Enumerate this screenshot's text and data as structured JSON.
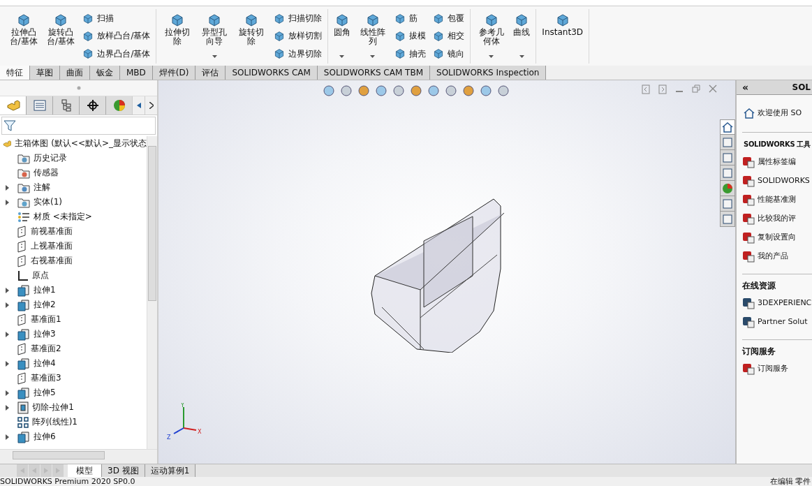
{
  "ribbon": {
    "groups": [
      {
        "items": [
          {
            "kind": "large",
            "label": "拉伸凸台/基体",
            "dropdown": false
          },
          {
            "kind": "large",
            "label": "旋转凸台/基体",
            "dropdown": false
          },
          {
            "kind": "stack",
            "labels": [
              "扫描",
              "放样凸台/基体",
              "边界凸台/基体"
            ]
          }
        ]
      },
      {
        "items": [
          {
            "kind": "large",
            "label": "拉伸切除",
            "dropdown": false
          },
          {
            "kind": "large",
            "label": "异型孔向导",
            "dropdown": true
          },
          {
            "kind": "large",
            "label": "旋转切除",
            "dropdown": false
          },
          {
            "kind": "stack",
            "labels": [
              "扫描切除",
              "放样切割",
              "边界切除"
            ]
          }
        ]
      },
      {
        "items": [
          {
            "kind": "large",
            "label": "圆角",
            "dropdown": true
          },
          {
            "kind": "large",
            "label": "线性阵列",
            "dropdown": true
          },
          {
            "kind": "stack",
            "labels": [
              "筋",
              "拔模",
              "抽壳"
            ]
          },
          {
            "kind": "stack",
            "labels": [
              "包覆",
              "相交",
              "镜向"
            ]
          }
        ]
      },
      {
        "items": [
          {
            "kind": "large",
            "label": "参考几何体",
            "dropdown": true
          },
          {
            "kind": "large",
            "label": "曲线",
            "dropdown": true
          }
        ]
      },
      {
        "items": [
          {
            "kind": "large",
            "label": "Instant3D",
            "dropdown": false
          }
        ]
      }
    ]
  },
  "tabs": [
    {
      "label": "特征",
      "selected": true
    },
    {
      "label": "草图",
      "selected": false
    },
    {
      "label": "曲面",
      "selected": false
    },
    {
      "label": "钣金",
      "selected": false
    },
    {
      "label": "MBD",
      "selected": false
    },
    {
      "label": "焊件(D)",
      "selected": false
    },
    {
      "label": "评估",
      "selected": false
    },
    {
      "label": "SOLIDWORKS CAM",
      "selected": false
    },
    {
      "label": "SOLIDWORKS CAM TBM",
      "selected": false
    },
    {
      "label": "SOLIDWORKS Inspection",
      "selected": false
    }
  ],
  "panel_tabs": [
    {
      "selected": true
    },
    {
      "selected": false
    },
    {
      "selected": false
    },
    {
      "selected": false
    },
    {
      "selected": false
    }
  ],
  "tree": {
    "label": "主箱体图  (默认<<默认>_显示状态",
    "children": [
      {
        "label": "历史记录",
        "kind": "history"
      },
      {
        "label": "传感器",
        "kind": "sensor"
      },
      {
        "label": "注解",
        "kind": "annotation",
        "expanded": false
      },
      {
        "label": "实体(1)",
        "kind": "solid",
        "expanded": false
      },
      {
        "label": "材质 <未指定>",
        "kind": "material"
      },
      {
        "label": "前视基准面",
        "kind": "plane"
      },
      {
        "label": "上视基准面",
        "kind": "plane"
      },
      {
        "label": "右视基准面",
        "kind": "plane"
      },
      {
        "label": "原点",
        "kind": "origin"
      },
      {
        "label": "拉伸1",
        "kind": "extrude",
        "expanded": false
      },
      {
        "label": "拉伸2",
        "kind": "extrude",
        "expanded": false
      },
      {
        "label": "基准面1",
        "kind": "plane"
      },
      {
        "label": "拉伸3",
        "kind": "extrude",
        "expanded": false
      },
      {
        "label": "基准面2",
        "kind": "plane"
      },
      {
        "label": "拉伸4",
        "kind": "extrude",
        "expanded": false
      },
      {
        "label": "基准面3",
        "kind": "plane"
      },
      {
        "label": "拉伸5",
        "kind": "extrude",
        "expanded": false
      },
      {
        "label": "切除-拉伸1",
        "kind": "cut",
        "expanded": false
      },
      {
        "label": "阵列(线性)1",
        "kind": "pattern"
      },
      {
        "label": "拉伸6",
        "kind": "extrude",
        "expanded": false
      }
    ]
  },
  "triad": {
    "y": "Y",
    "x": "X",
    "z": "Z"
  },
  "side_tabs": [
    {
      "selected": true
    },
    {
      "selected": false
    },
    {
      "selected": false
    },
    {
      "selected": false
    },
    {
      "selected": false
    },
    {
      "selected": false
    },
    {
      "selected": false
    }
  ],
  "task_pane": {
    "collapse": "«",
    "title": "SOL",
    "welcome": "欢迎使用  SO",
    "sections": [
      {
        "title": "SOLIDWORKS 工具",
        "items": [
          "属性标签编",
          "SOLIDWORKS",
          "性能基准测",
          "比较我的评",
          "复制设置向",
          "我的产品"
        ]
      },
      {
        "title": "在线资源",
        "items": [
          "3DEXPERIENC",
          "Partner Solut"
        ]
      },
      {
        "title": "订阅服务",
        "items": [
          "订阅服务"
        ]
      }
    ]
  },
  "bottom_tabs": [
    {
      "label": "模型",
      "selected": true
    },
    {
      "label": "3D 视图",
      "selected": false
    },
    {
      "label": "运动算例1",
      "selected": false
    }
  ],
  "status_bar": {
    "left": "SOLIDWORKS Premium 2020 SP0.0",
    "right": "在编辑  零件"
  }
}
